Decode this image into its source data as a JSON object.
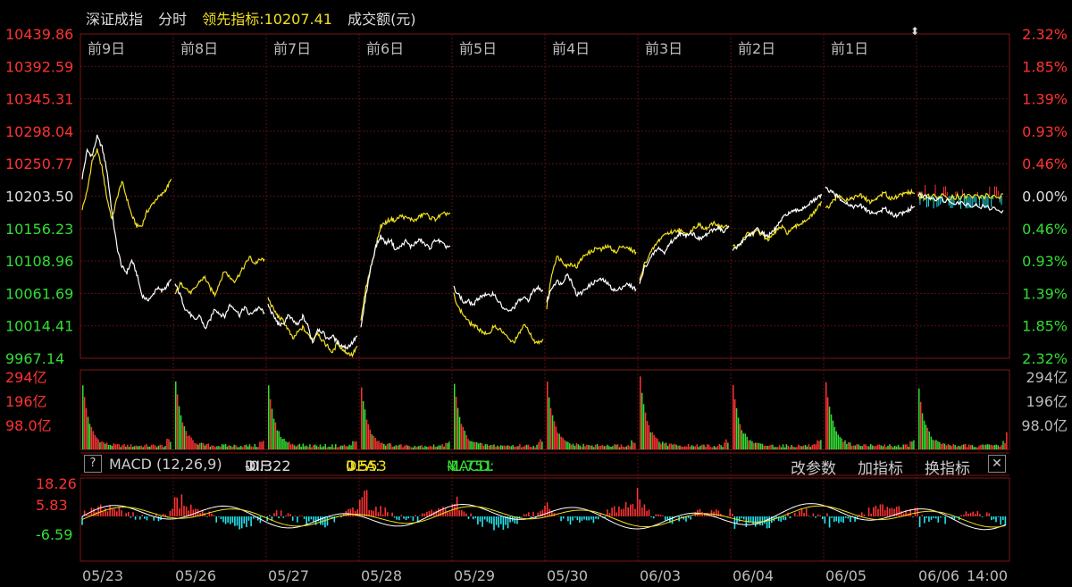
{
  "header": {
    "index_name": "深证成指",
    "period": "分时",
    "leading_label": "领先指标:",
    "leading_value": "10207.41",
    "volume_label": "成交额(元)"
  },
  "macd": {
    "help": "?",
    "title": "MACD (12,26,9)",
    "dif_label": "DIF:",
    "dif_value": "-0.322",
    "dif_arrow": "↓",
    "dea_label": "DEA:",
    "dea_value": "0.553",
    "dea_arrow": "↓",
    "macd_label": "MACD:",
    "macd_value": "-1.751",
    "macd_arrow": "↓",
    "change_params": "改参数",
    "add_indicator": "加指标",
    "switch_indicator": "换指标",
    "close": "✕"
  },
  "colors": {
    "up": "#ff3232",
    "down": "#33dd33",
    "cyan": "#22e6f0",
    "price_line": "#ffffff",
    "lead_line": "#f0e020",
    "grid": "#5a1010",
    "background": "#000000",
    "axis_text": "#bbbbbb"
  },
  "chart_data": [
    {
      "type": "line",
      "name": "price",
      "day_labels": [
        "前9日",
        "前8日",
        "前7日",
        "前6日",
        "前5日",
        "前4日",
        "前3日",
        "前2日",
        "前1日",
        ""
      ],
      "y_axis_left": [
        "10439.86",
        "10392.59",
        "10345.31",
        "10298.04",
        "10250.77",
        "10203.50",
        "10156.23",
        "10108.96",
        "10061.69",
        "10014.41",
        "9967.14"
      ],
      "y_axis_right": [
        "2.32%",
        "1.85%",
        "1.39%",
        "0.93%",
        "0.46%",
        "0.00%",
        "0.46%",
        "0.93%",
        "1.39%",
        "1.85%",
        "2.32%"
      ],
      "ylim": [
        9967.14,
        10439.86
      ],
      "base": 10203.5,
      "series": [
        {
          "line": "price",
          "values": [
            [
              10230,
              10270,
              10262,
              10290,
              10275,
              10240,
              10180,
              10130,
              10100,
              10092,
              10110,
              10090,
              10060,
              10052,
              10056,
              10070,
              10065,
              10072,
              10082
            ],
            [
              10075,
              10060,
              10040,
              10032,
              10022,
              10030,
              10010,
              10022,
              10040,
              10032,
              10028,
              10045,
              10040,
              10030,
              10042,
              10030,
              10037,
              10040,
              10034
            ],
            [
              10045,
              10030,
              10018,
              10015,
              10030,
              10022,
              10015,
              10028,
              10015,
              9990,
              10010,
              10005,
              9995,
              10000,
              9990,
              9985,
              9983,
              9990,
              10000
            ],
            [
              10010,
              10060,
              10100,
              10130,
              10145,
              10135,
              10140,
              10125,
              10130,
              10138,
              10130,
              10135,
              10140,
              10132,
              10128,
              10140,
              10137,
              10130,
              10130
            ],
            [
              10070,
              10060,
              10048,
              10050,
              10045,
              10055,
              10060,
              10058,
              10062,
              10050,
              10040,
              10035,
              10040,
              10050,
              10055,
              10052,
              10065,
              10070,
              10066
            ],
            [
              10050,
              10070,
              10080,
              10075,
              10090,
              10080,
              10060,
              10062,
              10070,
              10075,
              10080,
              10082,
              10078,
              10070,
              10065,
              10070,
              10075,
              10072,
              10068
            ],
            [
              10075,
              10100,
              10110,
              10122,
              10128,
              10120,
              10135,
              10140,
              10150,
              10145,
              10150,
              10148,
              10140,
              10145,
              10150,
              10155,
              10158,
              10150,
              10160
            ],
            [
              10125,
              10130,
              10138,
              10145,
              10150,
              10155,
              10150,
              10145,
              10150,
              10160,
              10170,
              10178,
              10180,
              10182,
              10185,
              10190,
              10195,
              10200,
              10205
            ],
            [
              10215,
              10210,
              10205,
              10200,
              10195,
              10190,
              10188,
              10190,
              10185,
              10180,
              10178,
              10182,
              10185,
              10180,
              10175,
              10178,
              10180,
              10185,
              10188
            ]
          ]
        },
        {
          "line": "leading",
          "values": [
            [
              10185,
              10210,
              10255,
              10270,
              10245,
              10200,
              10170,
              10200,
              10225,
              10200,
              10175,
              10160,
              10160,
              10180,
              10190,
              10200,
              10205,
              10215,
              10228
            ],
            [
              10060,
              10075,
              10072,
              10062,
              10068,
              10080,
              10085,
              10070,
              10060,
              10078,
              10095,
              10085,
              10080,
              10090,
              10102,
              10115,
              10105,
              10110,
              10112
            ],
            [
              10055,
              10040,
              10028,
              10022,
              10010,
              9995,
              10005,
              10012,
              10002,
              9995,
              10005,
              9992,
              9985,
              9975,
              9990,
              9980,
              9975,
              9972,
              9985
            ],
            [
              10020,
              10070,
              10100,
              10130,
              10160,
              10165,
              10170,
              10168,
              10175,
              10172,
              10170,
              10168,
              10175,
              10178,
              10172,
              10170,
              10175,
              10178,
              10178
            ],
            [
              10060,
              10040,
              10030,
              10020,
              10015,
              10010,
              10005,
              10000,
              10015,
              10010,
              10005,
              9995,
              9990,
              10000,
              10015,
              10010,
              9992,
              9990,
              9995
            ],
            [
              10040,
              10090,
              10115,
              10110,
              10102,
              10105,
              10100,
              10112,
              10120,
              10122,
              10128,
              10125,
              10130,
              10128,
              10120,
              10132,
              10128,
              10125,
              10122
            ],
            [
              10080,
              10105,
              10118,
              10130,
              10140,
              10148,
              10150,
              10152,
              10155,
              10148,
              10150,
              10158,
              10162,
              10155,
              10158,
              10165,
              10160,
              10158,
              10160
            ],
            [
              10132,
              10128,
              10140,
              10150,
              10148,
              10152,
              10148,
              10140,
              10145,
              10155,
              10158,
              10150,
              10155,
              10160,
              10165,
              10170,
              10175,
              10185,
              10195
            ],
            [
              10185,
              10190,
              10200,
              10205,
              10198,
              10200,
              10202,
              10205,
              10200,
              10195,
              10198,
              10205,
              10208,
              10200,
              10202,
              10205,
              10208,
              10210,
              10207
            ]
          ]
        }
      ]
    },
    {
      "type": "bar",
      "name": "volume",
      "y_axis_left": [
        "294亿",
        "196亿",
        "98.0亿"
      ],
      "y_axis_right": [
        "294亿",
        "196亿",
        "98.0亿"
      ],
      "ylim": [
        0,
        294
      ],
      "opening_spike_values": [
        250,
        260,
        240,
        235,
        250,
        255,
        275,
        245,
        260,
        230
      ]
    },
    {
      "type": "bar",
      "name": "macd",
      "y_axis_left": [
        "18.26",
        "5.83",
        "-6.59"
      ],
      "ylim": [
        -6.59,
        18.26
      ],
      "x_labels": [
        "05/23",
        "05/26",
        "05/27",
        "05/28",
        "05/29",
        "05/30",
        "06/03",
        "06/04",
        "06/05",
        "06/06",
        "14:00"
      ]
    }
  ]
}
